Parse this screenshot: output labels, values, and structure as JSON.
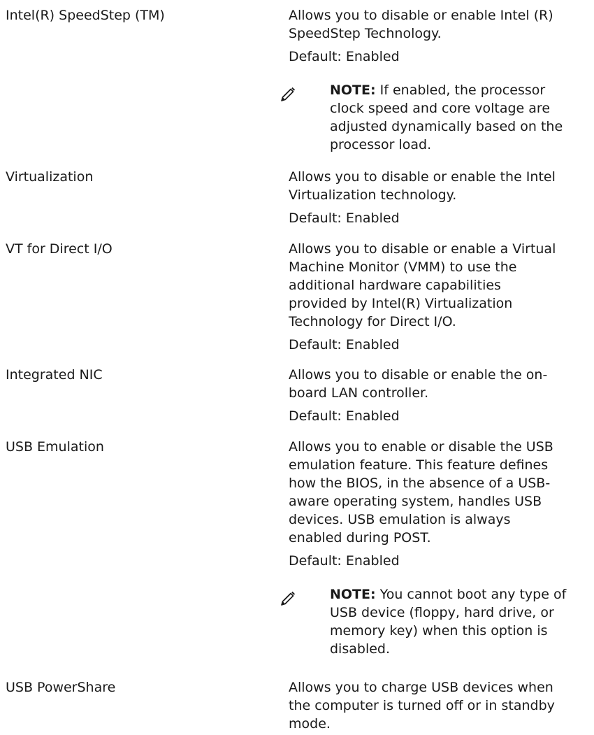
{
  "rows": [
    {
      "option": "Intel(R) SpeedStep (TM)",
      "desc_lines": [
        "Allows you to disable or enable Intel (R)",
        "SpeedStep Technology."
      ],
      "default": "Default: Enabled",
      "note": {
        "label": "NOTE:",
        "lines": [
          " If enabled, the processor",
          "clock speed and core voltage are",
          "adjusted dynamically based on the",
          "processor load."
        ]
      }
    },
    {
      "option": "Virtualization",
      "desc_lines": [
        "Allows you to disable or enable the Intel",
        "Virtualization technology."
      ],
      "default": "Default: Enabled"
    },
    {
      "option": "VT for Direct I/O",
      "desc_lines": [
        "Allows you to disable or enable a Virtual",
        "Machine Monitor (VMM) to use the",
        "additional hardware capabilities",
        "provided by Intel(R) Virtualization",
        "Technology for Direct I/O."
      ],
      "default": "Default: Enabled"
    },
    {
      "option": "Integrated NIC",
      "desc_lines": [
        "Allows you to disable or enable the on-",
        "board LAN controller."
      ],
      "default": "Default: Enabled"
    },
    {
      "option": "USB Emulation",
      "desc_lines": [
        "Allows you to enable or disable the USB",
        "emulation feature. This feature defines",
        "how the BIOS, in the absence of a USB-",
        "aware operating system, handles USB",
        "devices. USB emulation is always",
        "enabled during POST."
      ],
      "default": "Default: Enabled",
      "note": {
        "label": "NOTE:",
        "lines": [
          " You cannot boot any type of",
          "USB device (floppy, hard drive, or",
          "memory key) when this option is",
          "disabled."
        ]
      }
    },
    {
      "option": "USB PowerShare",
      "desc_lines": [
        "Allows you to charge USB devices when",
        "the computer is turned off or in standby",
        "mode."
      ]
    }
  ],
  "icons": {
    "note": "note-pencil-icon"
  }
}
